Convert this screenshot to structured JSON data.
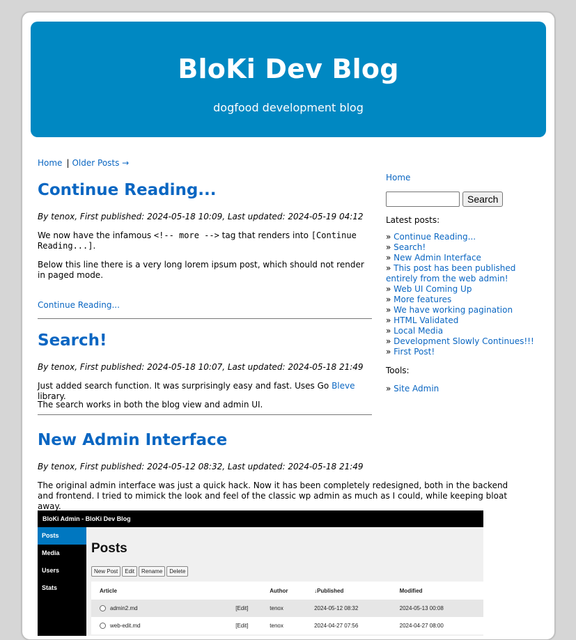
{
  "site": {
    "title": "BloKi Dev Blog",
    "tagline": "dogfood development blog"
  },
  "topnav": {
    "home": "Home",
    "separator": "|",
    "older": "Older Posts →"
  },
  "posts": [
    {
      "title": "Continue Reading...",
      "meta": "By tenox, First published: 2024-05-18 10:09, Last updated: 2024-05-19 04:12",
      "p1_pre": "We now have the infamous ",
      "p1_code": "<!-- more -->",
      "p1_mid": " tag that renders into ",
      "p1_code2": "[Continue Reading...]",
      "p1_post": ".",
      "p2": "Below this line there is a very long lorem ipsum post, which should not render in paged mode.",
      "more": "Continue Reading..."
    },
    {
      "title": "Search!",
      "meta": "By tenox, First published: 2024-05-18 10:07, Last updated: 2024-05-18 21:49",
      "p1_pre": "Just added search function. It was surprisingly easy and fast. Uses Go ",
      "p1_link": "Bleve",
      "p1_post": " library.",
      "p2": "The search works in both the blog view and admin UI."
    },
    {
      "title": "New Admin Interface",
      "meta": "By tenox, First published: 2024-05-12 08:32, Last updated: 2024-05-18 21:49",
      "p1": "The original admin interface was just a quick hack. Now it has been completely redesigned, both in the backend and frontend. I tried to mimick the look and feel of the classic wp admin as much as I could, while keeping bloat away."
    }
  ],
  "sidebar": {
    "home": "Home",
    "search_placeholder": "",
    "search_button": "Search",
    "latest_heading": "Latest posts:",
    "bullet": "»",
    "latest": [
      "Continue Reading...",
      "Search!",
      "New Admin Interface",
      "This post has been published entirely from the web admin!",
      "Web UI Coming Up",
      "More features",
      "We have working pagination",
      "HTML Validated",
      "Local Media",
      "Development Slowly Continues!!!",
      "First Post!"
    ],
    "tools_heading": "Tools:",
    "tools": [
      "Site Admin"
    ]
  },
  "admin_screenshot": {
    "topbar": "BloKi Admin - BloKi Dev Blog",
    "nav": [
      "Posts",
      "Media",
      "Users",
      "Stats"
    ],
    "heading": "Posts",
    "buttons": [
      "New Post",
      "Edit",
      "Rename",
      "Delete"
    ],
    "columns": [
      "Article",
      "",
      "Author",
      "↓Published",
      "Modified"
    ],
    "rows": [
      {
        "article": "admin2.md",
        "edit": "[Edit]",
        "author": "tenox",
        "published": "2024-05-12 08:32",
        "modified": "2024-05-13 00:08"
      },
      {
        "article": "web-edit.md",
        "edit": "[Edit]",
        "author": "tenox",
        "published": "2024-04-27 07:56",
        "modified": "2024-04-27 08:00"
      }
    ]
  }
}
